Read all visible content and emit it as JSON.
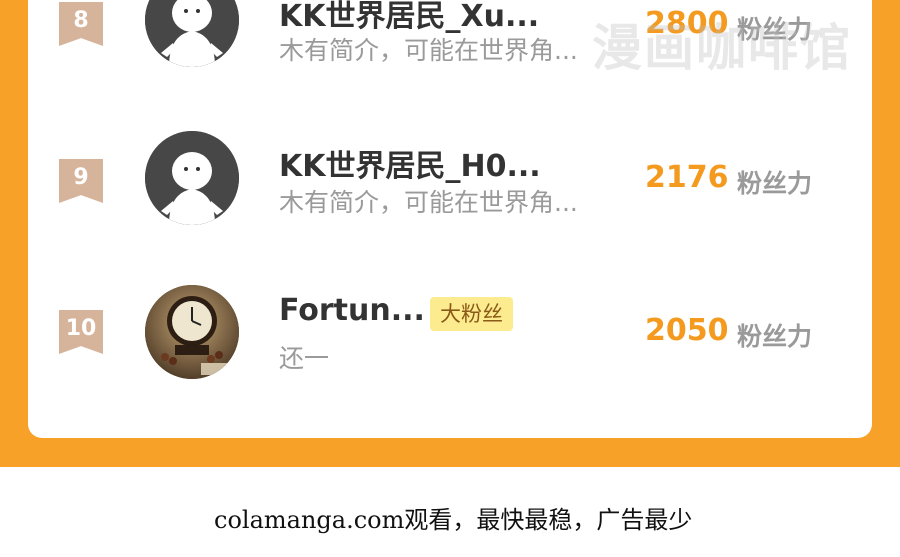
{
  "colors": {
    "frame_orange": "#f8a128",
    "fans_orange": "#f39a1f",
    "rank_tag": "#d6b49c",
    "badge_bg": "#fdeb8f"
  },
  "rows": [
    {
      "rank": "8",
      "name": "KK世界居民_Xu...",
      "intro": "木有简介，可能在世界角...",
      "fans_count": "2800",
      "fans_unit": "粉丝力",
      "avatar": "default-ghost-avatar"
    },
    {
      "rank": "9",
      "name": "KK世界居民_H0...",
      "intro": "木有简介，可能在世界角...",
      "fans_count": "2176",
      "fans_unit": "粉丝力",
      "avatar": "default-ghost-avatar"
    },
    {
      "rank": "10",
      "name": "Fortun...",
      "badge": "大粉丝",
      "intro": "还一",
      "fans_count": "2050",
      "fans_unit": "粉丝力",
      "avatar": "clock-photo-avatar"
    }
  ],
  "watermark": "漫画咖啡馆",
  "footer": "colamanga.com观看，最快最稳，广告最少"
}
